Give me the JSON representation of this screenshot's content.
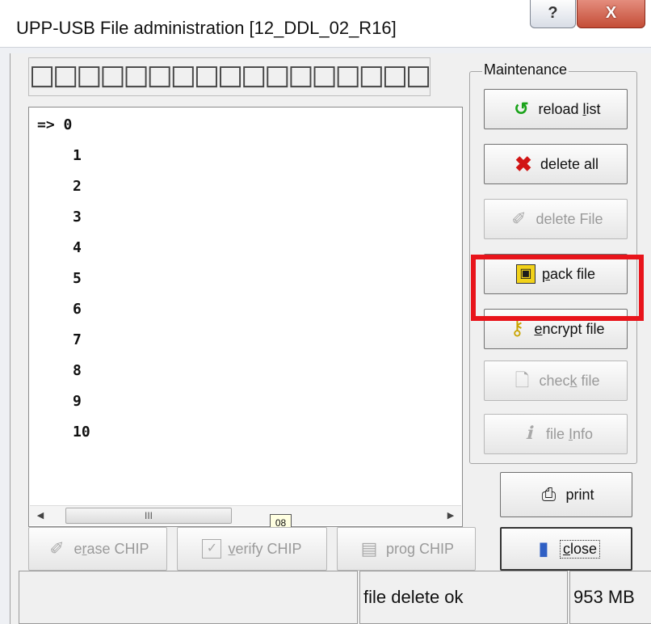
{
  "window": {
    "title": "UPP-USB File administration [12_DDL_02_R16]",
    "help_glyph": "?",
    "close_glyph": "X"
  },
  "editor": {
    "value": "□□□□□□□□□□□□□□□□□□□□□□□□□□□□□"
  },
  "file_list": {
    "marker": "=>",
    "items": [
      "0",
      "1",
      "2",
      "3",
      "4",
      "5",
      "6",
      "7",
      "8",
      "9",
      "10"
    ],
    "scroll_left": "◀",
    "scroll_right": "▶",
    "scroll_thumb": "III"
  },
  "maintenance": {
    "label": "Maintenance",
    "reload_list": {
      "prefix": "reload ",
      "accel": "l",
      "rest": "ist"
    },
    "delete_all": {
      "text": "delete all"
    },
    "delete_file": {
      "text": "delete File"
    },
    "pack_file": {
      "accel": "p",
      "rest": "ack file"
    },
    "encrypt_file": {
      "accel": "e",
      "rest": "ncrypt file"
    },
    "check_file": {
      "prefix": "chec",
      "accel": "k",
      "rest": " file"
    },
    "file_info": {
      "prefix": "file ",
      "accel": "I",
      "rest": "nfo"
    }
  },
  "print_button": {
    "text": "print"
  },
  "close_button": {
    "accel": "c",
    "rest": "lose"
  },
  "chip": {
    "erase": {
      "prefix": "e",
      "accel": "r",
      "rest": "ase CHIP"
    },
    "verify": {
      "accel": "v",
      "rest": "erify CHIP"
    },
    "prog": {
      "prefix": "pro",
      "accel": "g",
      "rest": " CHIP"
    }
  },
  "tooltip": "08",
  "status": {
    "left": "",
    "message": "file delete ok",
    "size": "953 MB"
  },
  "colors": {
    "highlight_box": "#e8141b",
    "titlebar_close": "#c44d37"
  }
}
